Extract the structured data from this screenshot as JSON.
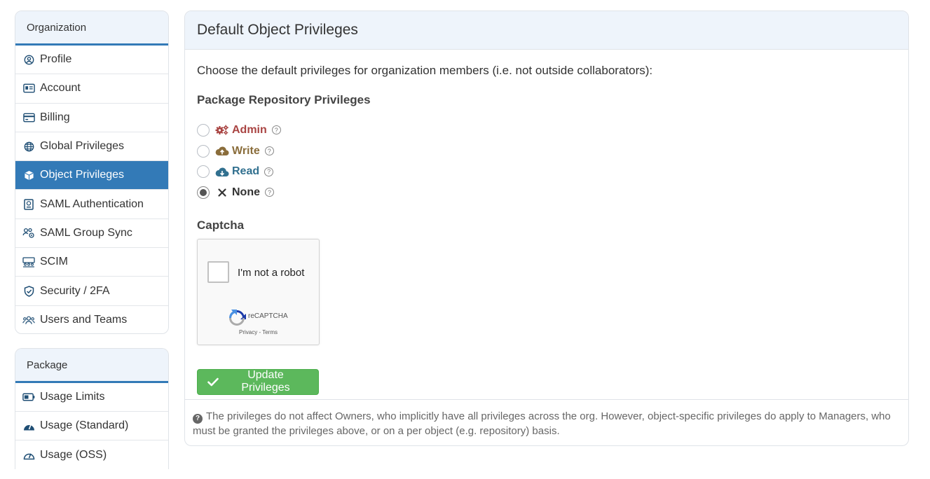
{
  "sidebar": {
    "organization": {
      "title": "Organization",
      "items": [
        {
          "label": "Profile",
          "icon": "user-circle-icon"
        },
        {
          "label": "Account",
          "icon": "id-card-icon"
        },
        {
          "label": "Billing",
          "icon": "credit-card-icon"
        },
        {
          "label": "Global Privileges",
          "icon": "globe-icon"
        },
        {
          "label": "Object Privileges",
          "icon": "cube-icon",
          "active": true
        },
        {
          "label": "SAML Authentication",
          "icon": "passport-icon"
        },
        {
          "label": "SAML Group Sync",
          "icon": "users-cog-icon"
        },
        {
          "label": "SCIM",
          "icon": "network-users-icon"
        },
        {
          "label": "Security / 2FA",
          "icon": "shield-check-icon"
        },
        {
          "label": "Users and Teams",
          "icon": "users-icon"
        }
      ]
    },
    "package": {
      "title": "Package",
      "items": [
        {
          "label": "Usage Limits",
          "icon": "battery-icon"
        },
        {
          "label": "Usage (Standard)",
          "icon": "gauge-icon"
        },
        {
          "label": "Usage (OSS)",
          "icon": "gauge-outline-icon"
        }
      ]
    }
  },
  "main": {
    "title": "Default Object Privileges",
    "intro": "Choose the default privileges for organization members (i.e. not outside collaborators):",
    "section_title": "Package Repository Privileges",
    "privileges": [
      {
        "label": "Admin",
        "icon": "cogs-icon",
        "color": "#a94442",
        "checked": false
      },
      {
        "label": "Write",
        "icon": "cloud-upload-icon",
        "color": "#8a6d3b",
        "checked": false
      },
      {
        "label": "Read",
        "icon": "cloud-download-icon",
        "color": "#31708f",
        "checked": false
      },
      {
        "label": "None",
        "icon": "times-icon",
        "color": "#333333",
        "checked": true
      }
    ],
    "captcha": {
      "title": "Captcha",
      "label": "I'm not a robot",
      "brand": "reCAPTCHA",
      "privacy": "Privacy",
      "separator": " - ",
      "terms": "Terms"
    },
    "update_button": "Update Privileges",
    "footer_note": "The privileges do not affect Owners, who implicitly have all privileges across the org. However, object-specific privileges do apply to Managers, who must be granted the privileges above, or on a per object (e.g. repository) basis."
  },
  "colors": {
    "accent": "#337ab7",
    "success": "#5cb85c"
  }
}
